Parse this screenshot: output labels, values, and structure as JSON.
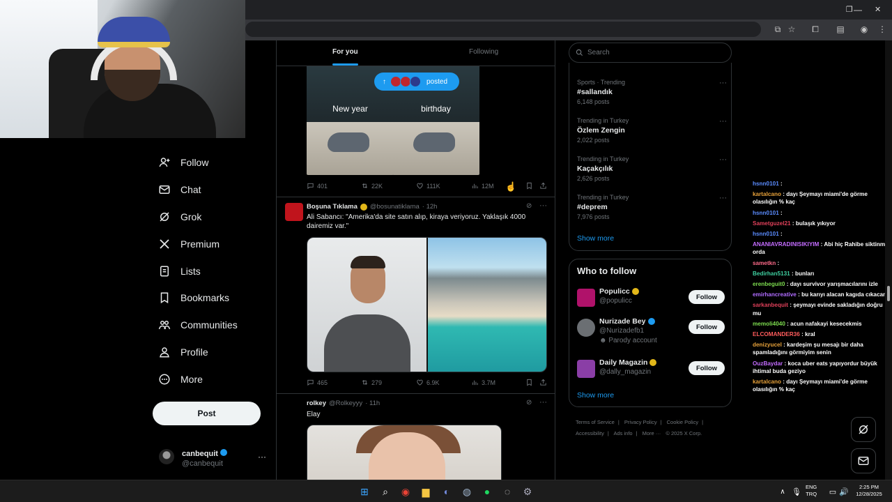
{
  "feed": {
    "tabs": {
      "for_you": "For you",
      "following": "Following"
    },
    "posted_pill": "posted",
    "meme": {
      "left_caption": "New year",
      "right_caption": "birthday"
    },
    "tweet1_actions": {
      "replies": "401",
      "reposts": "22K",
      "likes": "111K",
      "views": "12M"
    },
    "tweet2": {
      "name": "Boşuna Tıklama",
      "handle": "@bosunatiklama",
      "time": "· 12h",
      "text": "Ali Sabancı: \"Amerika'da site satın alıp, kiraya veriyoruz. Yaklaşık 4000 dairemiz var.\"",
      "actions": {
        "replies": "465",
        "reposts": "279",
        "likes": "6.9K",
        "views": "3.7M"
      }
    },
    "tweet3": {
      "name": "rolkey",
      "handle": "@Rolkeyyy",
      "time": "· 11h",
      "text": "Elay"
    }
  },
  "nav": {
    "items": [
      "Follow",
      "Chat",
      "Grok",
      "Premium",
      "Lists",
      "Bookmarks",
      "Communities",
      "Profile",
      "More"
    ],
    "post_label": "Post",
    "account": {
      "name": "canbequit",
      "handle": "@canbequit"
    }
  },
  "right": {
    "search_placeholder": "Search",
    "trends": [
      {
        "context": "Sports · Trending",
        "name": "#sallandık",
        "count": "6,148 posts"
      },
      {
        "context": "Trending in Turkey",
        "name": "Özlem Zengin",
        "count": "2,022 posts"
      },
      {
        "context": "Trending in Turkey",
        "name": "Kaçakçılık",
        "count": "2,626 posts"
      },
      {
        "context": "Trending in Turkey",
        "name": "#deprem",
        "count": "7,976 posts"
      }
    ],
    "show_more": "Show more",
    "who_to_follow_title": "Who to follow",
    "who_to_follow": [
      {
        "name": "Populicc",
        "handle": "@populicc",
        "extra": "",
        "button": "Follow"
      },
      {
        "name": "Nurizade Bey",
        "handle": "@Nurizadefb1",
        "extra": "Parody account",
        "button": "Follow"
      },
      {
        "name": "Daily Magazin",
        "handle": "@dally_magazin",
        "extra": "",
        "button": "Follow"
      }
    ],
    "footer": [
      "Terms of Service",
      "|",
      "Privacy Policy",
      "|",
      "Cookie Policy",
      "|",
      "Accessibility",
      "|",
      "Ads info",
      "|",
      "More ···",
      "© 2025 X Corp."
    ]
  },
  "chat": [
    {
      "user": "hsnn0101",
      "color": "#5b8cff",
      "text": ""
    },
    {
      "user": "kartalcano",
      "color": "#e8a23a",
      "text": "dayı Şeymayı miami'de görme olasılığın % kaç"
    },
    {
      "user": "hsnn0101",
      "color": "#5b8cff",
      "text": ""
    },
    {
      "user": "Sametguzel21",
      "color": "#e0405a",
      "text": "bulaşık yıkıyor"
    },
    {
      "user": "hsnn0101",
      "color": "#5b8cff",
      "text": ""
    },
    {
      "user": "ANANIAVRADINISIKIYIM",
      "color": "#c46cff",
      "text": "Abi hiç Rahibe siktinmi orda"
    },
    {
      "user": "sametkn",
      "color": "#ff6b8a",
      "text": ""
    },
    {
      "user": "Bedirhan5131",
      "color": "#3fd0a0",
      "text": "bunları"
    },
    {
      "user": "erenbeguit0",
      "color": "#7ddc4f",
      "text": "dayı survivor yarışmacılarını izle"
    },
    {
      "user": "emirhancreative",
      "color": "#b06cff",
      "text": "bu karıyı alacan kagıda cıkacan"
    },
    {
      "user": "sarkanbequit",
      "color": "#e0405a",
      "text": "şeymayı evinde sakladığın doğru mu"
    },
    {
      "user": "memoli4040",
      "color": "#7ddc4f",
      "text": "acun nafakayi kesecekmis"
    },
    {
      "user": "ELCOMANDER36",
      "color": "#ff5c5c",
      "text": "kral"
    },
    {
      "user": "denizyucel",
      "color": "#e8a23a",
      "text": "kardeşim şu mesajı bir daha spamladığını görmiyim senin"
    },
    {
      "user": "OuzBaydar",
      "color": "#c46cff",
      "text": "koca uber eats yapıyordur büyük ihtimal buda geziyo"
    },
    {
      "user": "kartalcano",
      "color": "#e8a23a",
      "text": "dayı Şeymayı miami'de görme olasılığın % kaç"
    }
  ],
  "taskbar": {
    "lang_top": "ENG",
    "lang_bottom": "TRQ",
    "time": "2:25 PM",
    "date": "12/28/2025"
  },
  "colors": {
    "accent": "#1d9bf0",
    "background": "#000000",
    "border": "#2f3336",
    "muted": "#71767b"
  }
}
